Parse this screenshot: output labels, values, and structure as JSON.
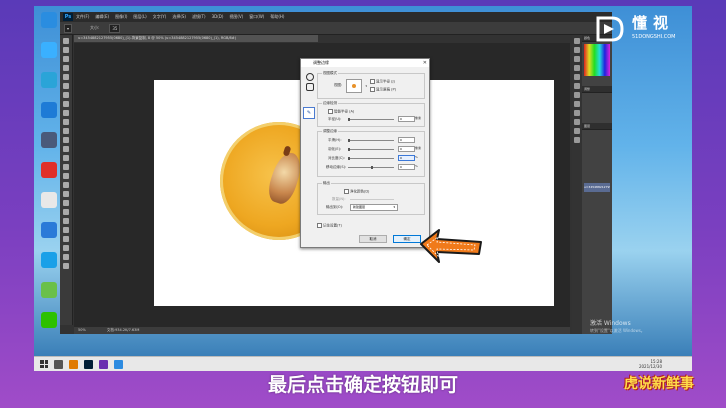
{
  "colors": {
    "accent": "#f07a1a",
    "frame": "#6b3fb0",
    "ps_bg": "#323232",
    "selection": "#3b78d8"
  },
  "desktop_icons": [
    {
      "label": "",
      "icon": "shield-icon",
      "color": "#2a8de0"
    },
    {
      "label": "",
      "icon": "app-icon",
      "color": "#3ab0ff"
    },
    {
      "label": "",
      "icon": "app-icon",
      "color": "#2aa4d8"
    },
    {
      "label": "",
      "icon": "app-icon",
      "color": "#1e7bd6"
    },
    {
      "label": "",
      "icon": "app-icon",
      "color": "#4a5a7a"
    },
    {
      "label": "",
      "icon": "wps-icon",
      "color": "#e0302a"
    },
    {
      "label": "",
      "icon": "app-icon",
      "color": "#e8e8e8"
    },
    {
      "label": "",
      "icon": "app-icon",
      "color": "#2a7ad8"
    },
    {
      "label": "",
      "icon": "qq-icon",
      "color": "#1aa0e8"
    },
    {
      "label": "",
      "icon": "app-icon",
      "color": "#6ac04a"
    },
    {
      "label": "",
      "icon": "wechat-icon",
      "color": "#2dc100"
    }
  ],
  "photoshop": {
    "logo": "Ps",
    "menus": [
      "文件(F)",
      "编辑(E)",
      "图像(I)",
      "图层(L)",
      "文字(Y)",
      "选择(S)",
      "滤镜(T)",
      "3D(D)",
      "视图(V)",
      "窗口(W)",
      "帮助(H)"
    ],
    "options": {
      "size_label": "大小:",
      "size_value": "35"
    },
    "doc_tab": "u=3454882127955(0680)_(1)-背景复制, 8 @ 50% (u=3454882127955(0680)_(1), RGB/8#)",
    "status_zoom": "50%",
    "status_doc": "文档:934.2K/7.63M",
    "layer_name": "u=3454882127955680",
    "panel_tabs": [
      "颜色",
      "调整",
      "图层"
    ]
  },
  "dialog": {
    "title": "调整边缘",
    "close": "✕",
    "view_mode_group": "视图模式",
    "view_label": "视图:",
    "show_radius": "显示半径 (J)",
    "show_original": "显示原稿 (P)",
    "edge_detection_group": "边缘检测",
    "smart_radius": "智能半径 (A)",
    "radius_label": "半径(U):",
    "radius_value": "0",
    "radius_unit": "像素",
    "adjust_edge_group": "调整边缘",
    "smooth_label": "平滑(H):",
    "smooth_value": "0",
    "feather_label": "羽化(E):",
    "feather_value": "0",
    "feather_unit": "像素",
    "contrast_label": "对比度(C):",
    "contrast_value": "0",
    "contrast_unit": "%",
    "shift_label": "移动边缘(S):",
    "shift_value": "0",
    "shift_unit": "%",
    "output_group": "输出",
    "decontaminate": "净化颜色(D)",
    "amount_label": "数量(N):",
    "output_to_label": "输出到(O):",
    "output_to_value": "新建图层",
    "remember": "记住设置(T)",
    "cancel": "取消",
    "ok": "确定"
  },
  "brand": {
    "name": "懂视",
    "url": "51DONGSHI.COM"
  },
  "watermark": {
    "line1": "激活 Windows",
    "line2": "转到\"设置\"以激活 Windows。"
  },
  "taskbar": {
    "time": "15:28",
    "date": "2021/12/30"
  },
  "subtitle": "最后点击确定按钮即可",
  "corner_logo": "虎说新鲜事"
}
